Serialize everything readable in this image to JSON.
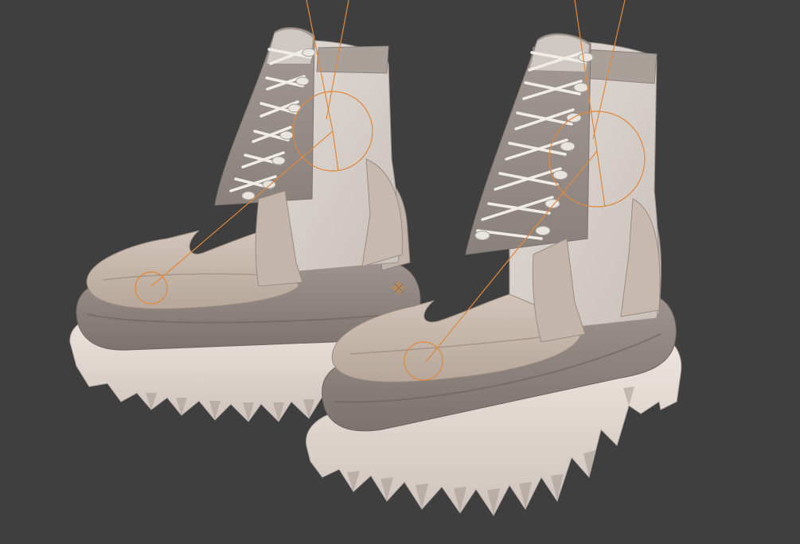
{
  "viewport": {
    "background": "#3f3f3f",
    "mode": "object",
    "shading": "solid"
  },
  "scene": {
    "objects": [
      {
        "name": "boot-left",
        "type": "mesh",
        "selected": false
      },
      {
        "name": "boot-right",
        "type": "mesh",
        "selected": false
      }
    ],
    "rig": {
      "bones_visible": true,
      "bone_color": "#e0893b",
      "controls": [
        "ankle-control-left",
        "toe-control-left",
        "ankle-control-right",
        "toe-control-right"
      ]
    },
    "cursor_3d": {
      "visible": true,
      "icon": "3d-cursor-icon"
    }
  },
  "colors": {
    "leather": "#c8b9ad",
    "upper": "#d9d1cb",
    "midsole": "#8f8580",
    "sole": "#e6dcd5",
    "laces": "#eeeae6",
    "shadow": "#6f6661"
  }
}
